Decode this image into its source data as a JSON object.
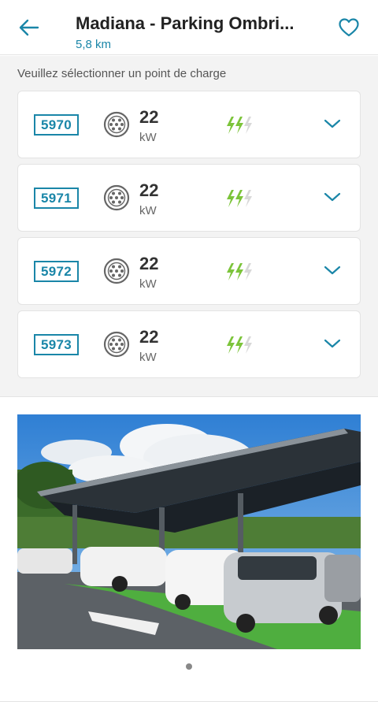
{
  "header": {
    "title": "Madiana - Parking Ombri...",
    "distance": "5,8 km"
  },
  "instruction": "Veuillez sélectionner un point de charge",
  "charge_points": [
    {
      "id": "5970",
      "power": "22",
      "unit": "kW"
    },
    {
      "id": "5971",
      "power": "22",
      "unit": "kW"
    },
    {
      "id": "5972",
      "power": "22",
      "unit": "kW"
    },
    {
      "id": "5973",
      "power": "22",
      "unit": "kW"
    }
  ],
  "icons": {
    "back": "arrow-left-icon",
    "favorite": "heart-outline-icon",
    "plug": "type2-plug-icon",
    "speed": "charging-speed-bolts-icon",
    "expand": "chevron-down-icon"
  },
  "colors": {
    "accent": "#1a86a8",
    "bolt_active": "#7cc43a",
    "bolt_inactive": "#d8d8d8"
  },
  "carousel": {
    "total_photos": 1,
    "current": 1
  }
}
